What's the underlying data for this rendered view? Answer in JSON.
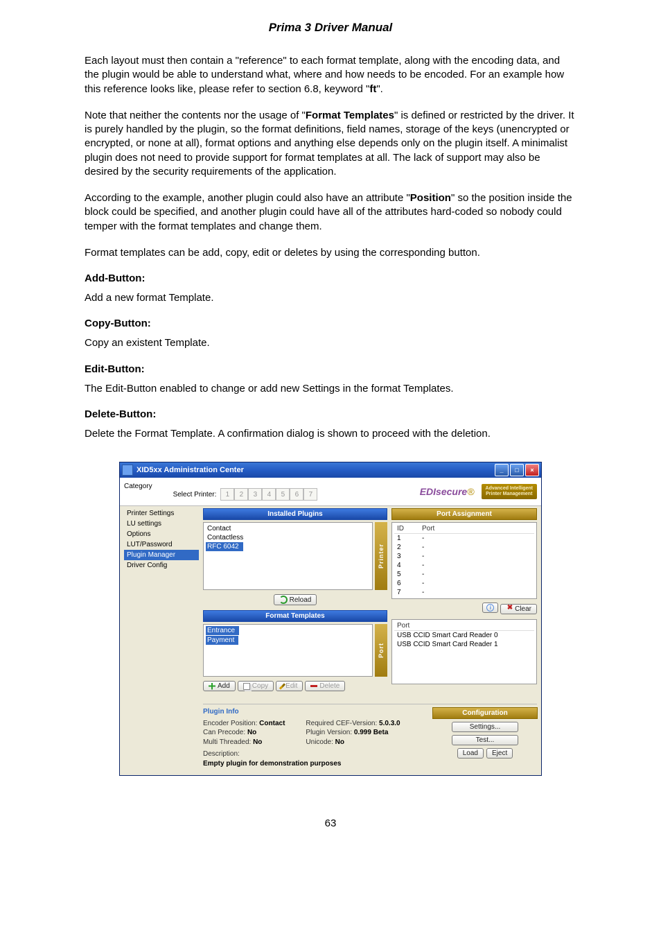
{
  "doc": {
    "title": "Prima 3 Driver Manual",
    "page_number": "63",
    "p1_part1": "Each layout must then contain a \"reference\" to each format template, along with the encoding data, and the plugin would be able to understand what, where and how needs to be encoded. For an example how this reference looks like, please refer to section 6.8, keyword \"",
    "p1_bold": "ft",
    "p1_part2": "\".",
    "p2_part1": "Note that neither the contents nor the usage of \"",
    "p2_bold": "Format Templates",
    "p2_part2": "\" is defined or restricted by the driver. It is purely handled by the plugin, so the format definitions, field names, storage of the keys (unencrypted or encrypted, or none at all), format options and anything else depends only on the plugin itself. A minimalist plugin does not need to provide support for format templates at all. The lack of support may also be desired by the security requirements of the application.",
    "p3_part1": "According to the example, another plugin could also have an attribute \"",
    "p3_bold": "Position",
    "p3_part2": "\" so the position inside the block could be specified, and another plugin could have all of the attributes hard-coded so nobody could temper with the format templates and change them.",
    "p4": "Format templates can be add, copy, edit or deletes by using the corresponding button.",
    "sec_add": "Add-Button:",
    "sec_add_body": "Add a new format Template.",
    "sec_copy": "Copy-Button:",
    "sec_copy_body": "Copy an existent Template.",
    "sec_edit": "Edit-Button:",
    "sec_edit_body": "The Edit-Button enabled to change or add new Settings in the format Templates.",
    "sec_del": "Delete-Button:",
    "sec_del_body": "Delete the Format Template. A confirmation dialog is shown to proceed with the deletion."
  },
  "win": {
    "title": "XID5xx Administration Center",
    "brand_edisecure": "EDIsecure",
    "brand_star": "®",
    "brand_badge_line1": "Advanced Intelligent",
    "brand_badge_line2": "Printer Management",
    "category_label": "Category",
    "select_printer_label": "Select Printer:",
    "printer_nums": [
      "1",
      "2",
      "3",
      "4",
      "5",
      "6",
      "7"
    ],
    "sidebar": [
      "Printer Settings",
      "LU settings",
      "Options",
      "LUT/Password",
      "Plugin Manager",
      "Driver Config"
    ],
    "sidebar_selected_index": 4,
    "panels": {
      "installed_plugins": "Installed Plugins",
      "format_templates": "Format Templates",
      "port_assignment": "Port Assignment",
      "configuration": "Configuration",
      "plugin_info": "Plugin Info"
    },
    "vtab_printer": "Printer",
    "vtab_port": "Port",
    "installed_plugins_items": [
      "Contact",
      "Contactless",
      "RFC 6042"
    ],
    "installed_plugins_selected_index": 2,
    "format_templates_items": [
      "Entrance",
      "Payment"
    ],
    "port_assignment": {
      "cols": [
        "ID",
        "Port"
      ],
      "rows": [
        {
          "id": "1",
          "port": "-"
        },
        {
          "id": "2",
          "port": "-"
        },
        {
          "id": "3",
          "port": "-"
        },
        {
          "id": "4",
          "port": "-"
        },
        {
          "id": "5",
          "port": "-"
        },
        {
          "id": "6",
          "port": "-"
        },
        {
          "id": "7",
          "port": "-"
        }
      ]
    },
    "clear_btn": "Clear",
    "port_list": {
      "header": "Port",
      "items": [
        "USB CCID Smart Card Reader 0",
        "USB CCID Smart Card Reader 1"
      ]
    },
    "btns": {
      "reload": "Reload",
      "add": "Add",
      "copy": "Copy",
      "edit": "Edit",
      "delete": "Delete",
      "settings": "Settings...",
      "test": "Test...",
      "load": "Load",
      "eject": "Eject"
    },
    "plugin_info_rows": {
      "encoder_position_k": "Encoder Position:",
      "encoder_position_v": "Contact",
      "can_precode_k": "Can Precode:",
      "can_precode_v": "No",
      "multi_threaded_k": "Multi Threaded:",
      "multi_threaded_v": "No",
      "required_cef_k": "Required CEF-Version:",
      "required_cef_v": "5.0.3.0",
      "plugin_version_k": "Plugin Version:",
      "plugin_version_v": "0.999 Beta",
      "unicode_k": "Unicode:",
      "unicode_v": "No",
      "desc_k": "Description:",
      "desc_v": "Empty plugin for demonstration purposes"
    }
  }
}
